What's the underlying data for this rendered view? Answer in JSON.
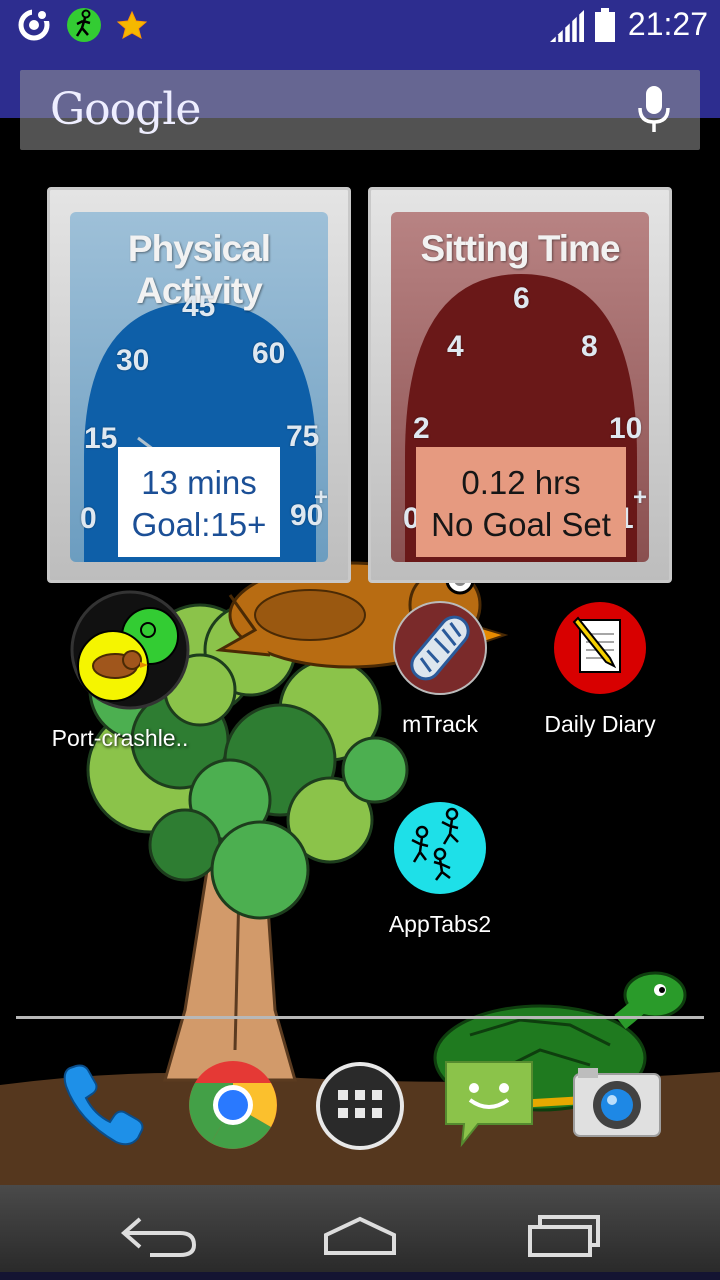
{
  "status_bar": {
    "time": "21:27",
    "icons": [
      "sync-circle-icon",
      "stick-figure-running-icon",
      "star-icon",
      "signal-icon",
      "battery-icon"
    ]
  },
  "search_bar": {
    "logo_text": "Google",
    "icon": "mic-icon"
  },
  "widgets": {
    "physical_activity": {
      "title": "Physical Activity",
      "ticks": [
        "0",
        "15",
        "30",
        "45",
        "60",
        "75",
        "90",
        "+"
      ],
      "value_text": "13 mins",
      "goal_text": "Goal:15+",
      "value": 13,
      "face_color": "#0e5fa8"
    },
    "sitting_time": {
      "title": "Sitting Time",
      "ticks": [
        "0",
        "2",
        "4",
        "6",
        "8",
        "10",
        "12",
        "+"
      ],
      "value_text": "0.12 hrs",
      "goal_text": "No Goal Set",
      "value": 0.12,
      "face_color": "#6a1818"
    }
  },
  "apps": [
    {
      "label": "Port-crashle..",
      "icon": "bird-yellow-circle-icon"
    },
    {
      "label": "mTrack",
      "icon": "shoe-sole-icon"
    },
    {
      "label": "Daily Diary",
      "icon": "notepad-pencil-icon"
    },
    {
      "label": "AppTabs2",
      "icon": "stick-figures-cyan-icon"
    }
  ],
  "dock": [
    "phone-icon",
    "chrome-icon",
    "app-drawer-icon",
    "messaging-icon",
    "camera-icon"
  ],
  "nav": [
    "back-icon",
    "home-icon",
    "recents-icon"
  ],
  "colors": {
    "status_bar": "#2d2d8f",
    "activity_readout": "#1b4f96",
    "sitting_readout_bg": "#e69a80"
  }
}
